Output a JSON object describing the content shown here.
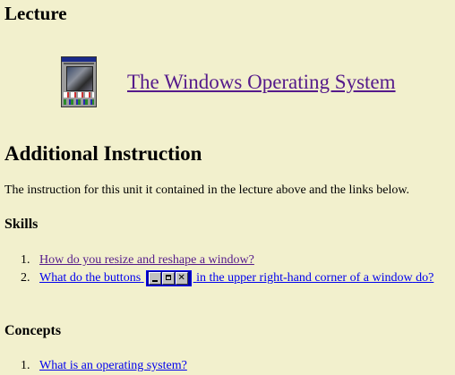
{
  "lecture": {
    "heading": "Lecture",
    "thumbnail_icon": "windows-screenshot-thumbnail",
    "link_text": "The Windows Operating System"
  },
  "additional": {
    "heading": "Additional Instruction",
    "intro": "The instruction for this unit it contained in the lecture above and the links below."
  },
  "skills": {
    "heading": "Skills",
    "items": [
      {
        "number": "1.",
        "text": "How do you resize and reshape a window?",
        "visited": true
      },
      {
        "number": "2.",
        "text_before": "What do the buttons",
        "icon": "window-control-buttons-icon",
        "text_after": "in the upper right-hand corner of a window",
        "text_wrap": "do?",
        "visited": false
      }
    ]
  },
  "concepts": {
    "heading": "Concepts",
    "items": [
      {
        "number": "1.",
        "text": "What is an operating system?",
        "visited": false
      }
    ]
  },
  "colors": {
    "background": "#f2f0cd",
    "visited_link": "#551a8b",
    "unvisited_link": "#0000ee"
  }
}
